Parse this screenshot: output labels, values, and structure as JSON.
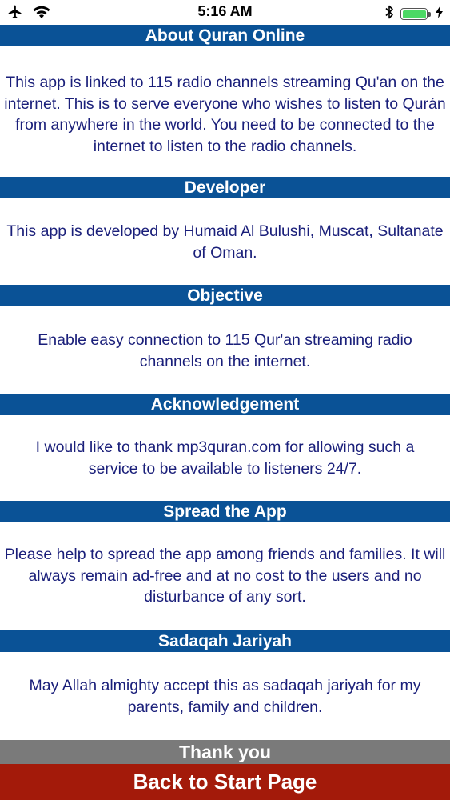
{
  "status_bar": {
    "time": "5:16 AM",
    "battery_color": "#4cd964"
  },
  "sections": [
    {
      "title": "About Quran Online",
      "body": "This app is linked to 115 radio channels streaming Qu'an on the internet. This is to serve everyone who wishes to listen to Qurán from anywhere in the world. You need to be connected to the internet to listen to the radio channels."
    },
    {
      "title": "Developer",
      "body": "This app is developed by Humaid Al Bulushi, Muscat, Sultanate of Oman."
    },
    {
      "title": "Objective",
      "body": "Enable easy connection to 115 Qur'an streaming radio channels on the internet."
    },
    {
      "title": "Acknowledgement",
      "body": "I would like to thank mp3quran.com for allowing such a service to be available to listeners 24/7."
    },
    {
      "title": "Spread the App",
      "body": "Please help to spread the app among friends and families. It will always remain ad-free and at no cost to the users and no disturbance of any sort."
    },
    {
      "title": "Sadaqah Jariyah",
      "body": "May Allah almighty accept this as sadaqah jariyah for my parents, family and children."
    }
  ],
  "footer": {
    "thank_you": "Thank you",
    "back_button": "Back to Start Page"
  },
  "colors": {
    "header_blue": "#0a5296",
    "body_text": "#1a1f7a",
    "thank_gray": "#7a7a7a",
    "back_red": "#a31a0a"
  },
  "icons": [
    "airplane-icon",
    "wifi-icon",
    "bluetooth-icon",
    "battery-icon",
    "charging-icon"
  ]
}
